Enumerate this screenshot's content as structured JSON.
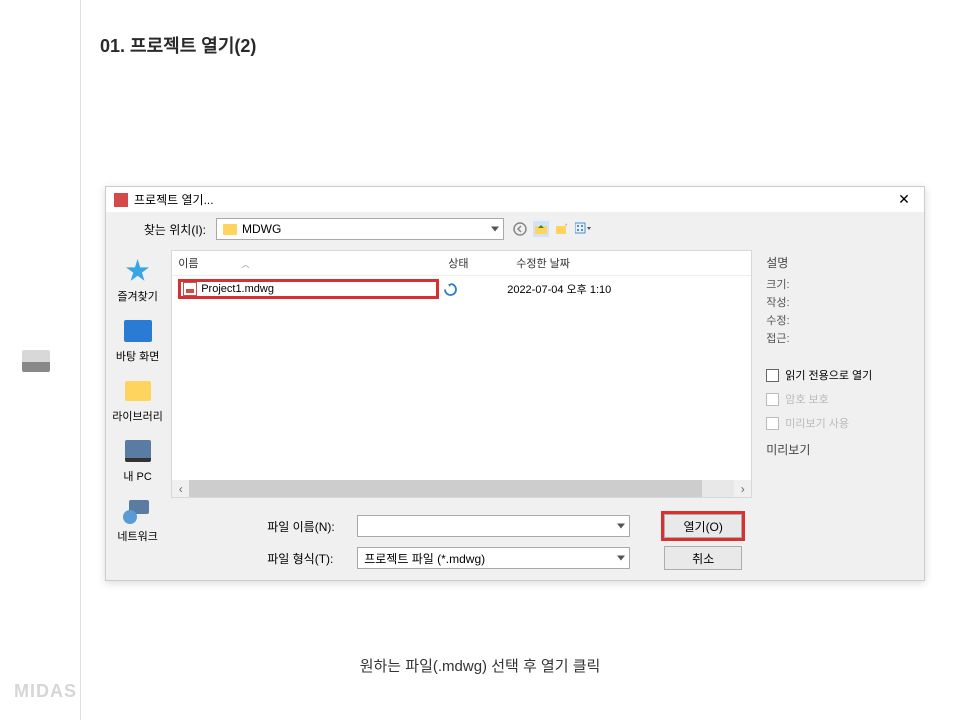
{
  "page_heading": "01. 프로젝트 열기(2)",
  "dialog": {
    "title": "프로젝트 열기...",
    "lookin_label": "찾는 위치(I):",
    "lookin_value": "MDWG",
    "columns": {
      "name": "이름",
      "state": "상태",
      "date": "수정한 날짜"
    },
    "file": {
      "name": "Project1.mdwg",
      "date": "2022-07-04 오후 1:10"
    },
    "filename_label": "파일 이름(N):",
    "filename_value": "",
    "filetype_label": "파일 형식(T):",
    "filetype_value": "프로젝트 파일 (*.mdwg)",
    "open_button": "열기(O)",
    "cancel_button": "취소"
  },
  "places": {
    "favorites": "즐겨찾기",
    "desktop": "바탕 화면",
    "libraries": "라이브러리",
    "this_pc": "내 PC",
    "network": "네트워크"
  },
  "right_panel": {
    "desc_heading": "설명",
    "size": "크기:",
    "created": "작성:",
    "modified": "수정:",
    "accessed": "접근:",
    "read_only": "읽기 전용으로 열기",
    "password": "암호 보호",
    "use_preview": "미리보기 사용",
    "preview_heading": "미리보기"
  },
  "instruction": "원하는 파일(.mdwg) 선택 후 열기 클릭",
  "brand": "MIDAS"
}
